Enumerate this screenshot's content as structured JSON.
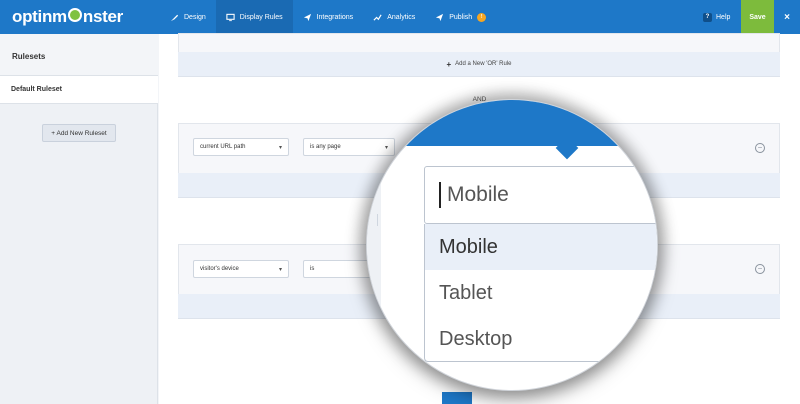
{
  "app": {
    "logo_text_1": "optinm",
    "logo_text_2": "nster"
  },
  "nav": {
    "items": [
      {
        "label": "Design",
        "icon": "brush-icon"
      },
      {
        "label": "Display Rules",
        "icon": "monitor-icon",
        "active": true
      },
      {
        "label": "Integrations",
        "icon": "paper-plane-icon"
      },
      {
        "label": "Analytics",
        "icon": "line-chart-icon"
      },
      {
        "label": "Publish",
        "icon": "send-icon",
        "badge": "!"
      }
    ],
    "help_label": "Help",
    "help_icon_glyph": "?",
    "save_label": "Save",
    "close_glyph": "×"
  },
  "sidebar": {
    "title": "Rulesets",
    "items": [
      {
        "label": "Default Ruleset"
      }
    ],
    "add_button_label": "+ Add New Ruleset"
  },
  "main": {
    "add_or_rule_label": "Add a New 'OR' Rule",
    "and_label": "AND",
    "rules": [
      {
        "field": "current URL path",
        "operator": "is any page"
      },
      {
        "field": "visitor's device",
        "operator": "is"
      }
    ]
  },
  "magnifier": {
    "input_value": "Mobile",
    "options": [
      "Mobile",
      "Tablet",
      "Desktop"
    ],
    "highlighted_option": "Mobile"
  },
  "colors": {
    "topbar": "#1e78c8",
    "save": "#7dbb3c",
    "highlight": "#e9eff8"
  }
}
